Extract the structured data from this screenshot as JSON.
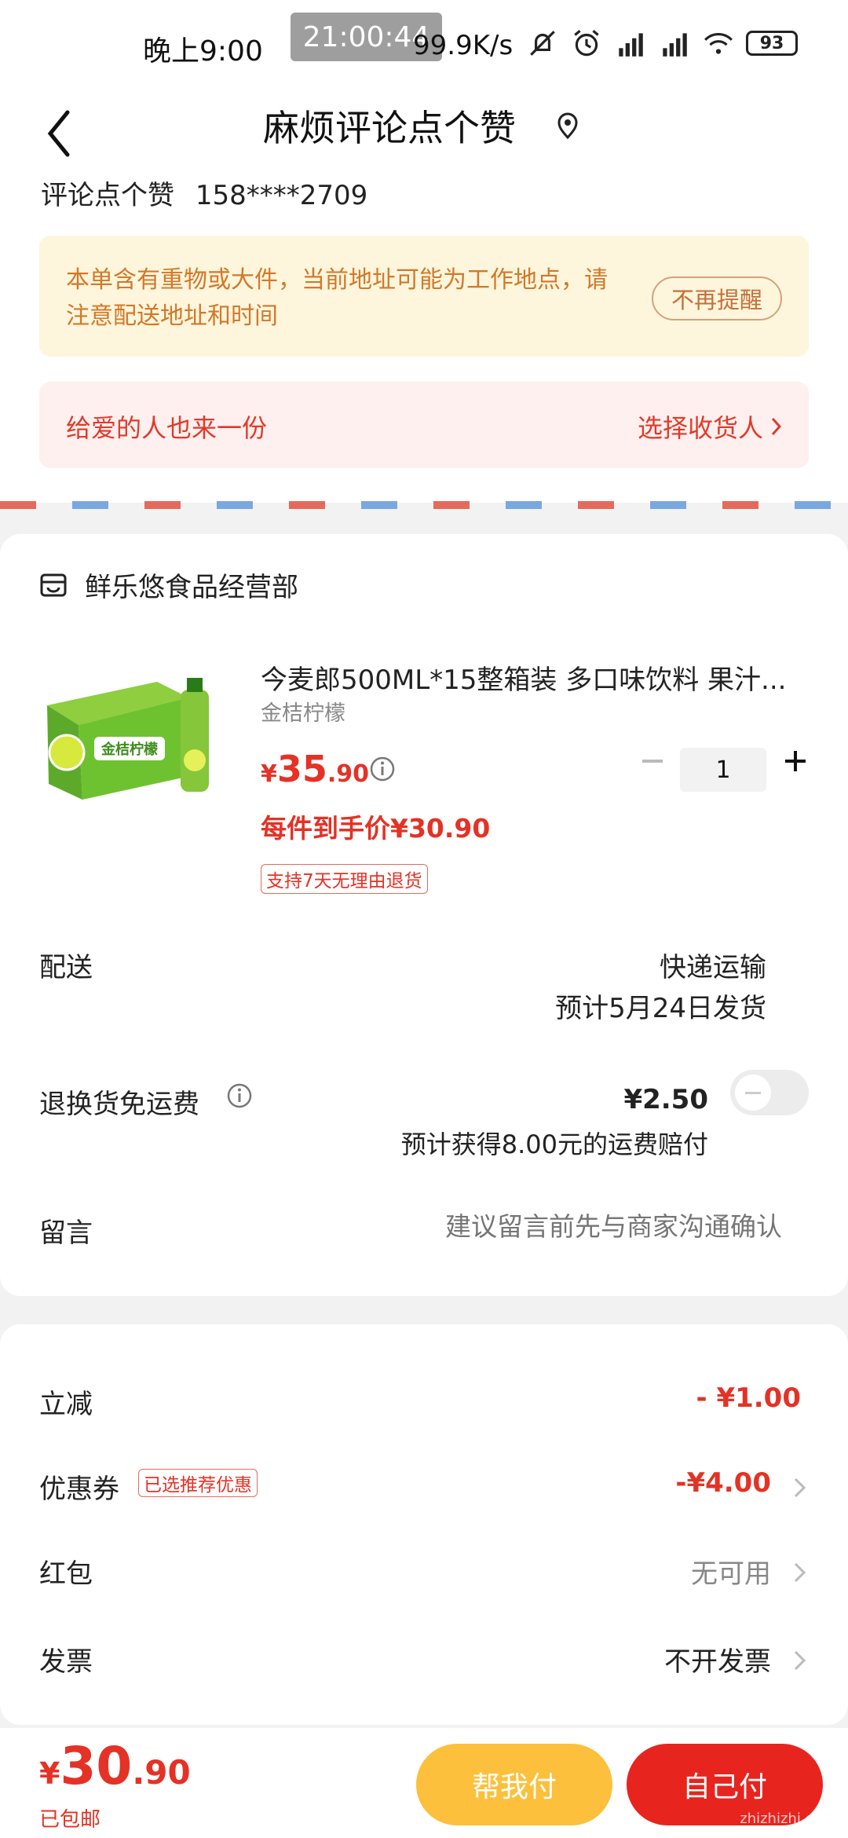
{
  "status_bar": {
    "time": "晚上9:00",
    "clock_overlay": "21:00:44",
    "speed": "99.9K/s",
    "battery": "93"
  },
  "header": {
    "title": "麻烦评论点个赞",
    "recipient_name": "评论点个赞",
    "recipient_phone": "158****2709"
  },
  "notice": {
    "warning_text": "本单含有重物或大件，当前地址可能为工作地点，请注意配送地址和时间",
    "dismiss_label": "不再提醒",
    "gift_text": "给爱的人也来一份",
    "gift_link": "选择收货人"
  },
  "shop": {
    "name": "鲜乐悠食品经营部",
    "product": {
      "title": "今麦郎500ML*15整箱装 多口味饮料 果汁...",
      "spec": "金桔柠檬",
      "price_yen": "¥",
      "price_int": "35",
      "price_dec": ".90",
      "quantity": "1",
      "per_item_price": "每件到手价¥30.90",
      "return_badge": "支持7天无理由退货",
      "image_text": "金桔柠檬"
    },
    "delivery_label": "配送",
    "delivery_method": "快递运输",
    "delivery_eta": "预计5月24日发货",
    "freight_label": "退换货免运费",
    "freight_price": "¥2.50",
    "freight_note": "预计获得8.00元的运费赔付",
    "message_label": "留言",
    "message_placeholder": "建议留言前先与商家沟通确认"
  },
  "discounts": {
    "instant_label": "立减",
    "instant_value": "- ¥1.00",
    "coupon_label": "优惠券",
    "coupon_tag": "已选推荐优惠",
    "coupon_value": "-¥4.00",
    "redpacket_label": "红包",
    "redpacket_value": "无可用",
    "invoice_label": "发票",
    "invoice_value": "不开发票"
  },
  "footer": {
    "total_yen": "¥",
    "total_int": "30",
    "total_dec": ".90",
    "shipping_note": "已包邮",
    "pay_friend_label": "帮我付",
    "pay_self_label": "自己付",
    "watermark": "zhizhizhi.com"
  },
  "colors": {
    "accent_red": "#e43226",
    "warning_bg": "#fdf6dc",
    "warning_text": "#d2782a",
    "pay_friend_bg": "#fcc03c",
    "pay_self_bg": "#e8241f"
  }
}
